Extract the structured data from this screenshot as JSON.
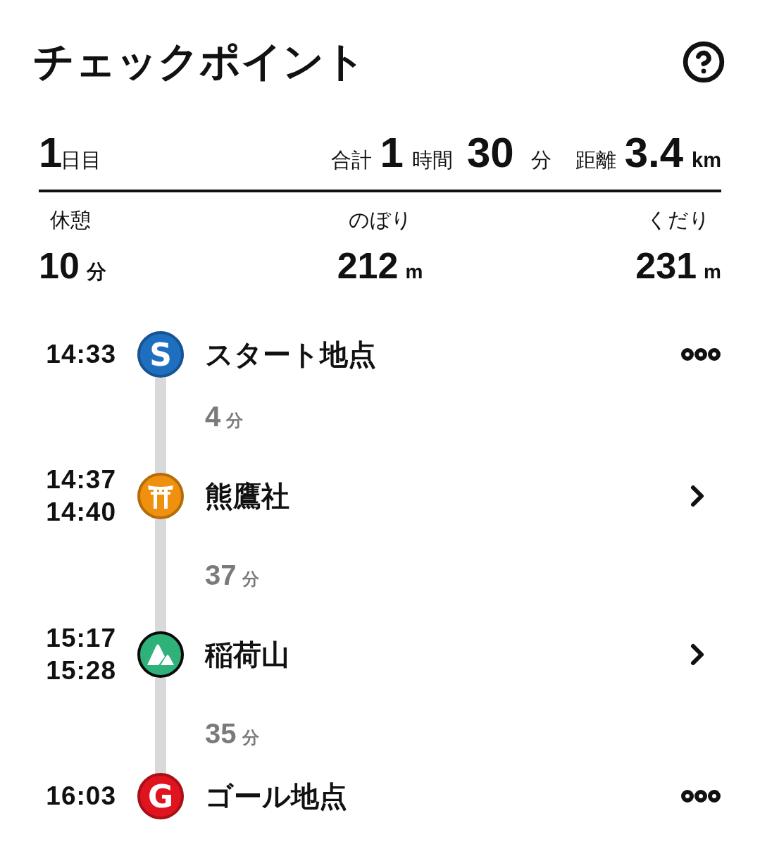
{
  "header": {
    "title": "チェックポイント"
  },
  "summary": {
    "day_number": "1",
    "day_suffix": "日目",
    "total_label": "合計",
    "hours": "1",
    "hours_unit": "時間",
    "minutes": "30",
    "minutes_unit": "分",
    "distance_label": "距離",
    "distance": "3.4",
    "distance_unit": "km"
  },
  "stats": [
    {
      "label": "休憩",
      "value": "10",
      "unit": "分"
    },
    {
      "label": "のぼり",
      "value": "212",
      "unit": "m"
    },
    {
      "label": "くだり",
      "value": "231",
      "unit": "m"
    }
  ],
  "checkpoints": [
    {
      "kind": "letter",
      "letter": "S",
      "color": "#1f6fc1",
      "times": [
        "14:33"
      ],
      "name": "スタート地点",
      "has_menu": true,
      "leg": {
        "value": "4",
        "unit": "分"
      }
    },
    {
      "kind": "shrine",
      "color": "#f0900f",
      "times": [
        "14:37",
        "14:40"
      ],
      "name": "熊鷹社",
      "has_menu": false,
      "leg": {
        "value": "37",
        "unit": "分"
      }
    },
    {
      "kind": "mountain",
      "color": "#2fb27a",
      "times": [
        "15:17",
        "15:28"
      ],
      "name": "稲荷山",
      "has_menu": false,
      "leg": {
        "value": "35",
        "unit": "分"
      }
    },
    {
      "kind": "letter",
      "letter": "G",
      "color": "#e0141e",
      "times": [
        "16:03"
      ],
      "name": "ゴール地点",
      "has_menu": true
    }
  ]
}
